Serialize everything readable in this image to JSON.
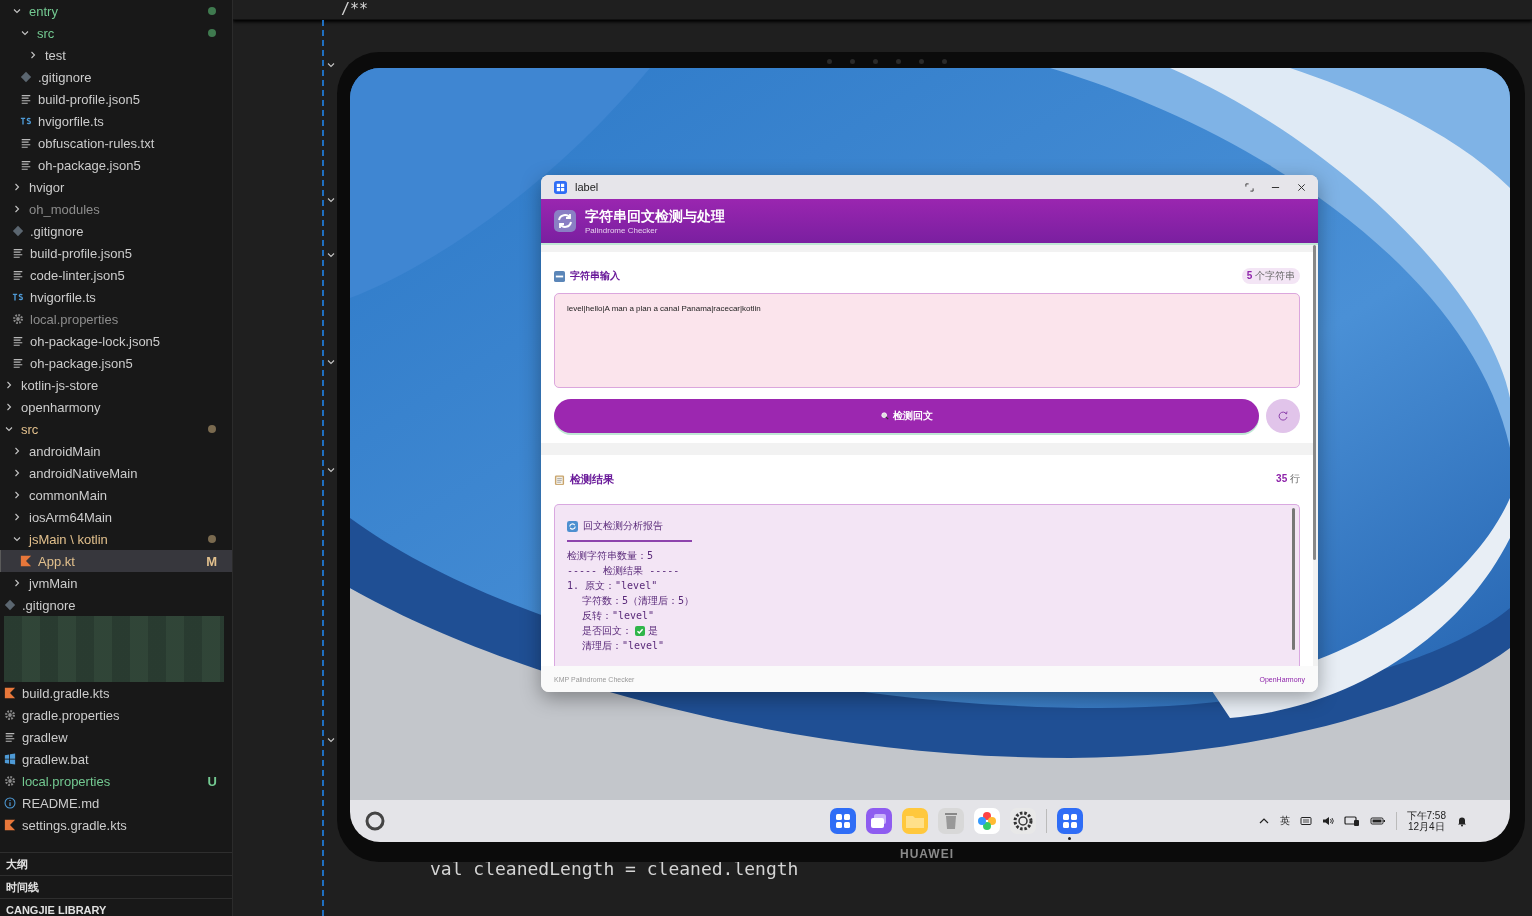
{
  "explorer": {
    "nested_group": [
      {
        "name": "entry",
        "kind": "folder",
        "expanded": true,
        "color": "#73c991",
        "status_dot": {
          "color": "#3f7a4f"
        },
        "selected": false,
        "children": [
          {
            "name": "src",
            "kind": "folder",
            "expanded": true,
            "color": "#73c991",
            "status_dot": {
              "color": "#3f7a4f"
            },
            "selected": false,
            "children": [
              {
                "name": "test",
                "kind": "folder",
                "expanded": false,
                "selected": false
              }
            ]
          },
          {
            "name": ".gitignore",
            "kind": "git-file",
            "selected": false
          },
          {
            "name": "build-profile.json5",
            "kind": "text-file",
            "selected": false
          },
          {
            "name": "hvigorfile.ts",
            "kind": "ts-file",
            "selected": false
          },
          {
            "name": "obfuscation-rules.txt",
            "kind": "text-file",
            "selected": false
          },
          {
            "name": "oh-package.json5",
            "kind": "text-file",
            "selected": false
          }
        ]
      },
      {
        "name": "hvigor",
        "kind": "folder",
        "expanded": false,
        "selected": false
      },
      {
        "name": "oh_modules",
        "kind": "folder",
        "expanded": false,
        "color": "#8c8c8c",
        "selected": false
      },
      {
        "name": ".gitignore",
        "kind": "git-file",
        "selected": false
      },
      {
        "name": "build-profile.json5",
        "kind": "text-file",
        "selected": false
      },
      {
        "name": "code-linter.json5",
        "kind": "text-file",
        "selected": false
      },
      {
        "name": "hvigorfile.ts",
        "kind": "ts-file",
        "selected": false
      },
      {
        "name": "local.properties",
        "kind": "settings-file",
        "color": "#8c8c8c",
        "selected": false
      },
      {
        "name": "oh-package-lock.json5",
        "kind": "text-file",
        "selected": false
      },
      {
        "name": "oh-package.json5",
        "kind": "text-file",
        "selected": false
      }
    ],
    "root": [
      {
        "name": "kotlin-js-store",
        "kind": "folder",
        "expanded": false,
        "selected": false
      },
      {
        "name": "openharmony",
        "kind": "folder",
        "expanded": false,
        "selected": false
      },
      {
        "name": "src",
        "kind": "folder",
        "expanded": true,
        "color": "#e2c08d",
        "status_dot": {
          "color": "#7a6a4f"
        },
        "selected": false,
        "children": [
          {
            "name": "androidMain",
            "kind": "folder",
            "expanded": false,
            "selected": false
          },
          {
            "name": "androidNativeMain",
            "kind": "folder",
            "expanded": false,
            "selected": false
          },
          {
            "name": "commonMain",
            "kind": "folder",
            "expanded": false,
            "selected": false
          },
          {
            "name": "iosArm64Main",
            "kind": "folder",
            "expanded": false,
            "selected": false
          },
          {
            "name": "jsMain \\ kotlin",
            "kind": "folder",
            "expanded": true,
            "color": "#e2c08d",
            "status_dot": {
              "color": "#7a6a4f"
            },
            "selected": false,
            "children": [
              {
                "name": "App.kt",
                "kind": "kotlin-file",
                "color": "#e2c08d",
                "badge": "M",
                "selected": true
              }
            ]
          },
          {
            "name": "jvmMain",
            "kind": "folder",
            "expanded": false,
            "selected": false
          }
        ]
      },
      {
        "name": ".gitignore",
        "kind": "git-file",
        "selected": false
      },
      {
        "kind": "redacted"
      },
      {
        "name": "build.gradle.kts",
        "kind": "kotlin-file",
        "selected": false
      },
      {
        "name": "gradle.properties",
        "kind": "settings-file",
        "selected": false
      },
      {
        "name": "gradlew",
        "kind": "text-file",
        "selected": false
      },
      {
        "name": "gradlew.bat",
        "kind": "windows-file",
        "selected": false
      },
      {
        "name": "local.properties",
        "kind": "settings-file",
        "color": "#73c991",
        "badge": "U",
        "selected": false
      },
      {
        "name": "README.md",
        "kind": "info-file",
        "selected": false
      },
      {
        "name": "settings.gradle.kts",
        "kind": "kotlin-file",
        "selected": false
      }
    ],
    "panels": [
      {
        "title": "大纲"
      },
      {
        "title": "时间线"
      },
      {
        "title": "CANGJIE LIBRARY"
      }
    ]
  },
  "editor": {
    "sticky_line": "/**",
    "code_line": "val cleanedLength = cleaned.length"
  },
  "tablet": {
    "brand": "HUAWEI",
    "window": {
      "title": "label",
      "header_title": "字符串回文检测与处理",
      "header_subtitle": "Palindrome Checker",
      "input_section": {
        "title": "字符串输入",
        "count": "5",
        "count_unit": "个字符串",
        "value": "level|hello|A man a plan a canal Panama|racecar|kotlin",
        "button": "检测回文"
      },
      "result_section": {
        "title": "检测结果",
        "count": "35",
        "count_unit": "行",
        "report": {
          "title": "回文检测分析报告",
          "lines": [
            {
              "kind": "text",
              "text": "检测字符串数量：5"
            },
            {
              "kind": "text",
              "text": "----- 检测结果 -----"
            },
            {
              "kind": "text",
              "text": "1. 原文：\"level\"",
              "children": [
                {
                  "kind": "text",
                  "text": "字符数：5（清理后：5）"
                },
                {
                  "kind": "text",
                  "text": "反转：\"level\""
                },
                {
                  "kind": "verdict",
                  "label": "是否回文：",
                  "palindrome": true,
                  "text": "是"
                },
                {
                  "kind": "text",
                  "text": "清理后：\"level\""
                }
              ]
            }
          ]
        }
      },
      "footer_left": "KMP Palindrome Checker",
      "footer_right": "OpenHarmony"
    },
    "taskbar": {
      "dock": [
        {
          "kind": "app-grid",
          "running": false
        },
        {
          "kind": "multiwindow",
          "running": false
        },
        {
          "kind": "files",
          "running": false
        },
        {
          "kind": "trash",
          "running": false
        },
        {
          "kind": "gallery",
          "running": false
        },
        {
          "kind": "settings",
          "running": false
        },
        {
          "kind": "app-grid",
          "running": true
        }
      ],
      "input_method": "英",
      "time": "下午7:58",
      "date": "12月4日"
    }
  }
}
